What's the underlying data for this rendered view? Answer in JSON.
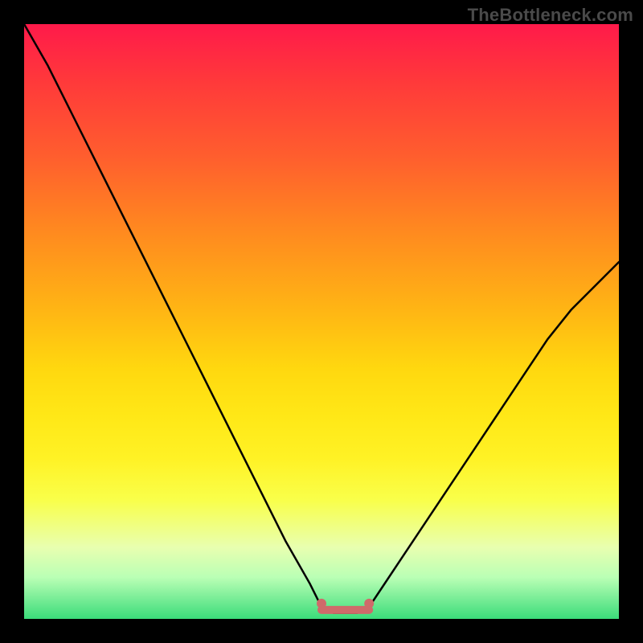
{
  "watermark": "TheBottleneck.com",
  "gradient_colors": {
    "top": "#ff1a4a",
    "mid_upper": "#ff8a1f",
    "mid": "#ffd80f",
    "mid_lower": "#f9ff4a",
    "bottom": "#3bdc7a"
  },
  "chart_data": {
    "type": "line",
    "title": "",
    "xlabel": "",
    "ylabel": "",
    "xlim": [
      0,
      100
    ],
    "ylim": [
      0,
      100
    ],
    "grid": false,
    "legend": false,
    "x": [
      0,
      4,
      8,
      12,
      16,
      20,
      24,
      28,
      32,
      36,
      40,
      44,
      48,
      50,
      52,
      54,
      56,
      58,
      60,
      64,
      68,
      72,
      76,
      80,
      84,
      88,
      92,
      96,
      100
    ],
    "values": [
      100,
      93,
      85,
      77,
      69,
      61,
      53,
      45,
      37,
      29,
      21,
      13,
      6,
      2,
      1,
      1,
      1,
      2,
      5,
      11,
      17,
      23,
      29,
      35,
      41,
      47,
      52,
      56,
      60
    ],
    "flat_region_x": [
      50,
      58
    ],
    "notes": "V-shaped bottleneck curve with a small flat minimum band; left branch steeper and reaches 100, right branch shallower reaching ~60 at the edge."
  }
}
